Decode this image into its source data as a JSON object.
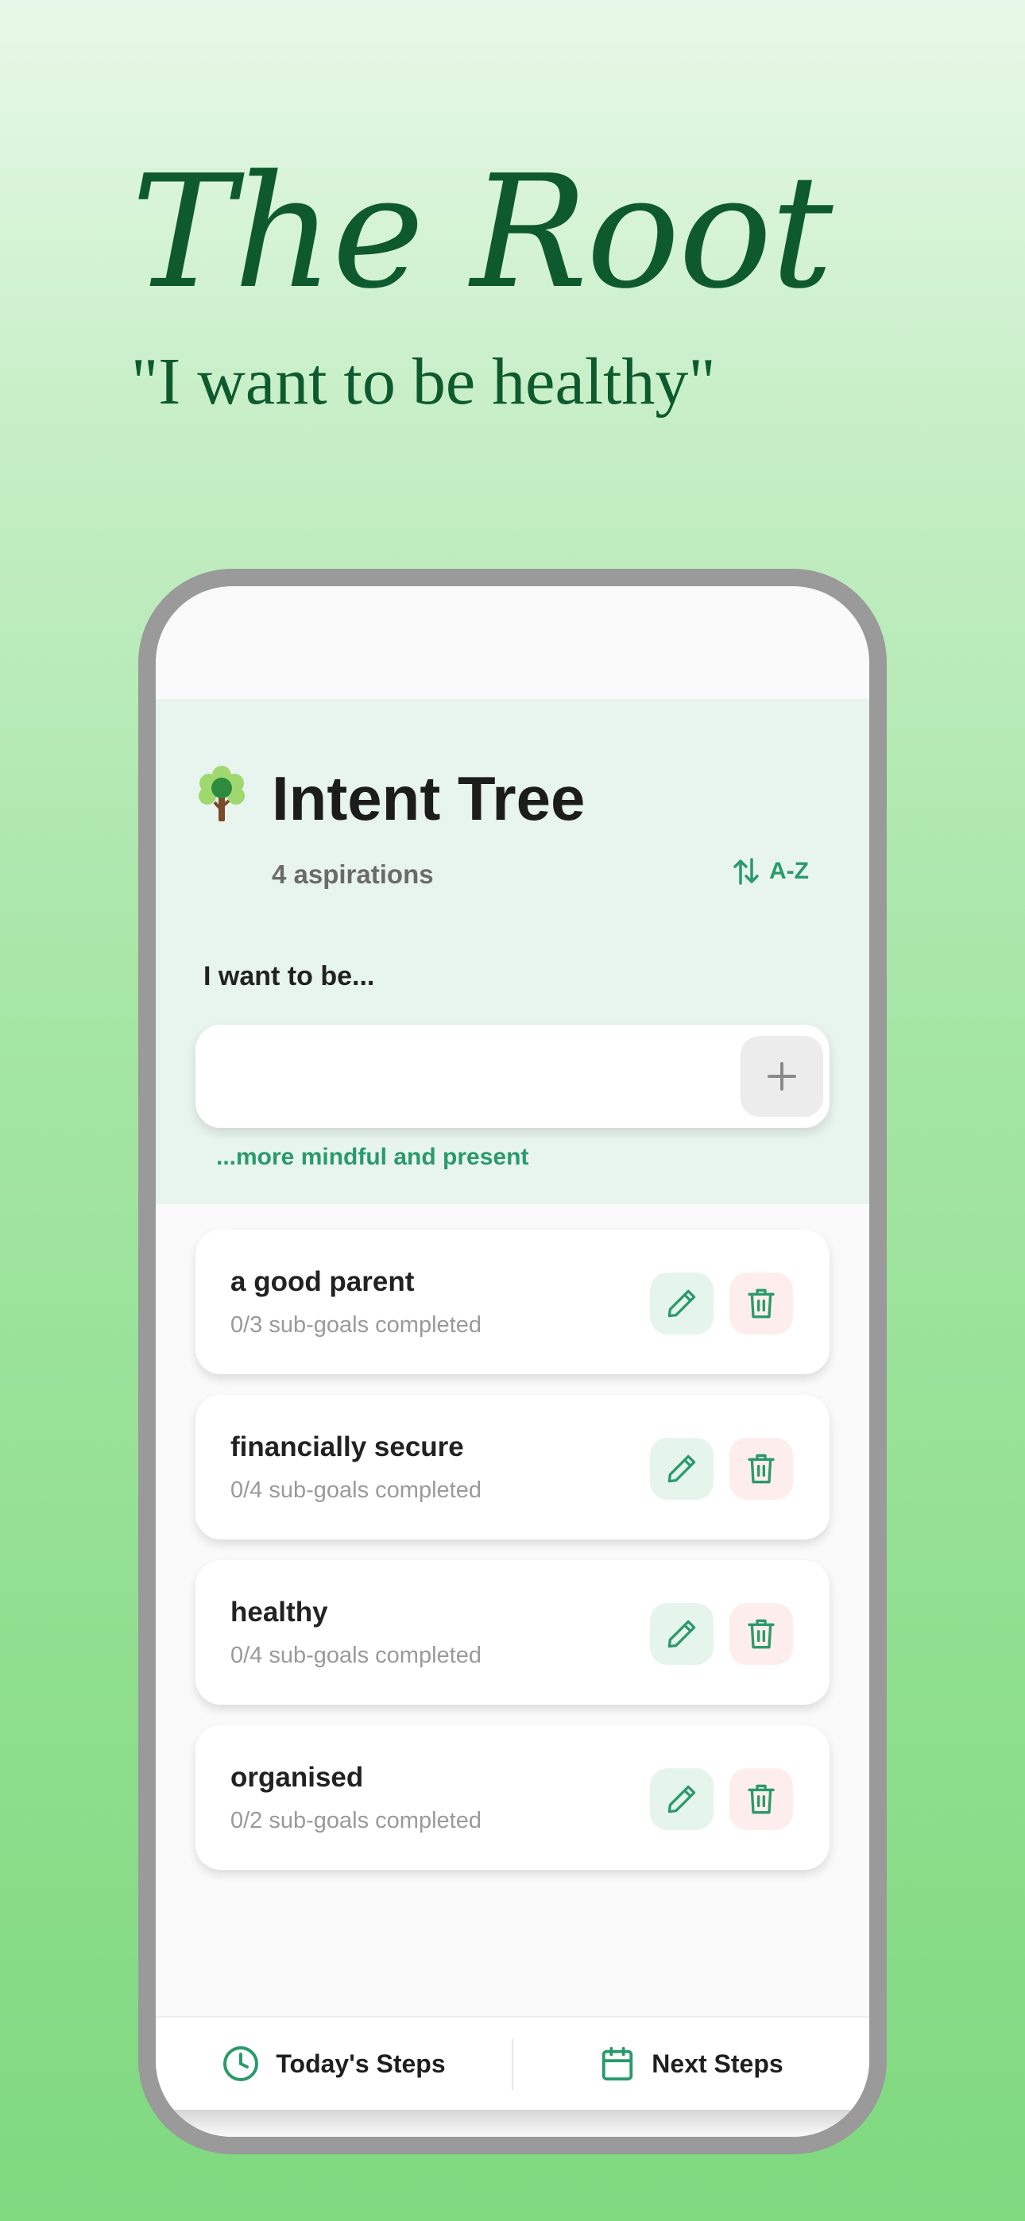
{
  "hero": {
    "title": "The Root",
    "subtitle": "\"I want to be healthy\""
  },
  "app": {
    "title": "Intent Tree",
    "count_text": "4 aspirations",
    "sort_label": "A-Z",
    "input_label": "I want to be...",
    "input_placeholder": "",
    "suggestion": "...more mindful and present"
  },
  "aspirations": [
    {
      "title": "a good parent",
      "progress": "0/3 sub-goals completed"
    },
    {
      "title": "financially secure",
      "progress": "0/4 sub-goals completed"
    },
    {
      "title": "healthy",
      "progress": "0/4 sub-goals completed"
    },
    {
      "title": "organised",
      "progress": "0/2 sub-goals completed"
    }
  ],
  "nav": {
    "today": "Today's Steps",
    "next": "Next Steps"
  },
  "icons": {
    "logo": "tree-icon",
    "sort": "sort-arrows-icon",
    "add": "plus-icon",
    "edit": "pencil-icon",
    "delete": "trash-icon",
    "today": "clock-icon",
    "next": "calendar-icon"
  },
  "colors": {
    "accent": "#2a9a6a",
    "hero_text": "#0e5a2e",
    "header_bg": "#e8f5ee",
    "edit_bg": "#e6f5ec",
    "delete_bg": "#fdeeed"
  }
}
